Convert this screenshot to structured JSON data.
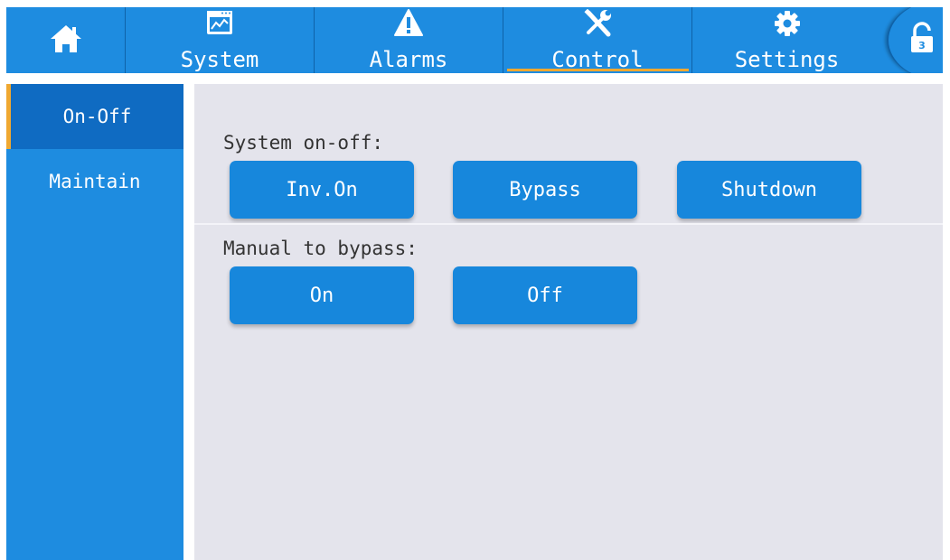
{
  "header": {
    "tabs": [
      {
        "label": "",
        "icon": "home-icon"
      },
      {
        "label": "System",
        "icon": "monitor-chart-icon"
      },
      {
        "label": "Alarms",
        "icon": "warning-icon"
      },
      {
        "label": "Control",
        "icon": "tools-icon",
        "active": true
      },
      {
        "label": "Settings",
        "icon": "gear-icon"
      }
    ],
    "lock": {
      "icon": "unlock-icon",
      "badge": "3"
    }
  },
  "sidebar": {
    "items": [
      {
        "label": "On-Off",
        "active": true
      },
      {
        "label": "Maintain"
      }
    ]
  },
  "main": {
    "system_onoff": {
      "label": "System on-off:",
      "buttons": [
        "Inv.On",
        "Bypass",
        "Shutdown"
      ]
    },
    "manual_bypass": {
      "label": "Manual to bypass:",
      "buttons": [
        "On",
        "Off"
      ]
    }
  },
  "colors": {
    "primary": "#1e8ce0",
    "active_sidebar": "#0f6bc2",
    "accent": "#f0a830",
    "content_bg": "#e4e4ec",
    "button": "#1787dc"
  }
}
